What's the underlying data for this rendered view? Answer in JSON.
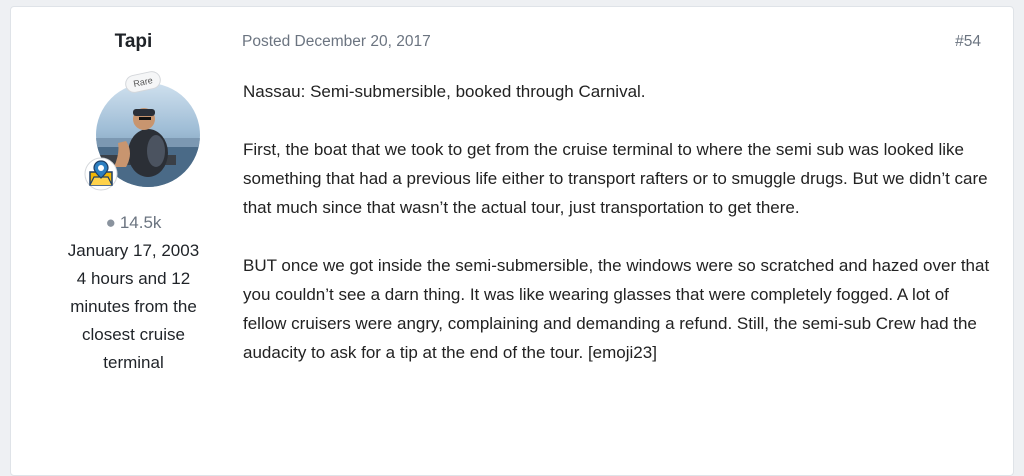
{
  "author": {
    "username": "Tapi",
    "rank_badge": "Rare",
    "badge_icon": "map-location-icon",
    "post_count": "14.5k",
    "joined": "January 17, 2003",
    "location_lines": [
      "4 hours and 12",
      "minutes from the",
      "closest cruise",
      "terminal"
    ]
  },
  "post": {
    "posted": "Posted December 20, 2017",
    "number": "#54",
    "paragraphs": [
      "Nassau: Semi-submersible, booked through Carnival.",
      "First, the boat that we took to get from the cruise terminal to where the semi sub was looked like something that had a previous life either to transport rafters or to smuggle drugs. But we didn’t care that much since that wasn’t the actual tour, just transportation to get there.",
      "BUT once we got inside the semi-submersible, the windows were so scratched and hazed over that you couldn’t see a darn thing. It was like wearing glasses that were completely fogged. A lot of fellow cruisers were angry, complaining and demanding a refund. Still, the semi-sub Crew had the audacity to ask for a tip at the end of the tour. [emoji23]"
    ]
  },
  "colors": {
    "background": "#eef0f3",
    "card": "#ffffff",
    "muted_text": "#6b7480",
    "badge_yellow": "#f2b705",
    "badge_blue": "#2d7fc1"
  }
}
